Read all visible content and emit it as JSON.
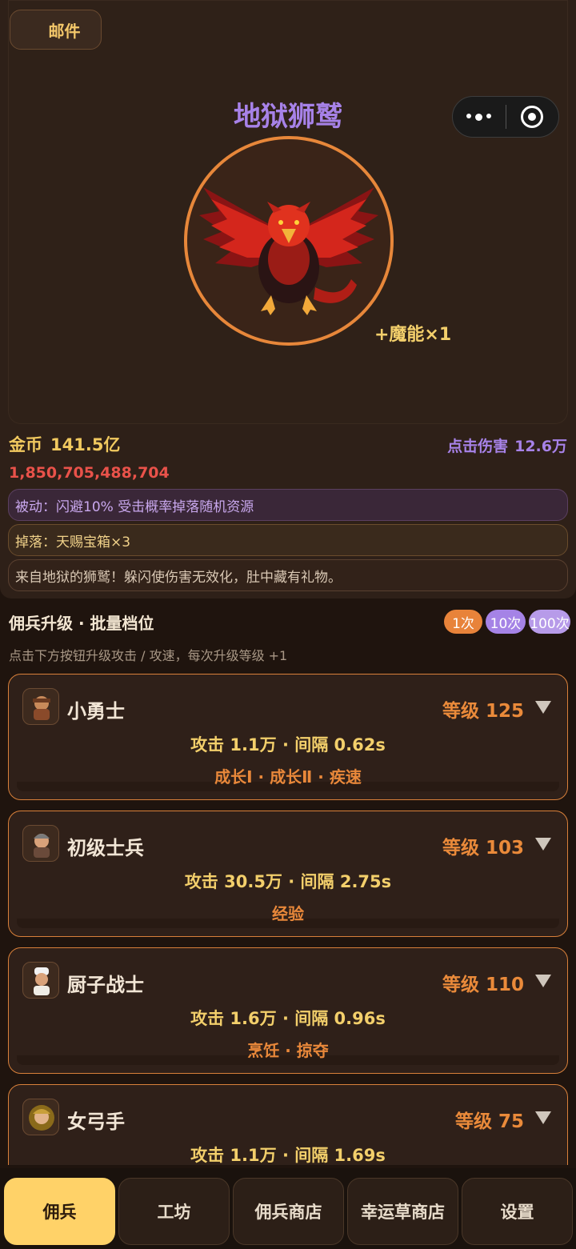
{
  "header": {
    "mail_label": "邮件",
    "capsule": {
      "more_icon": "more-dots-icon",
      "close_icon": "target-icon"
    }
  },
  "boss": {
    "name": "地狱狮鹫",
    "reward": "+魔能×1",
    "portrait": "hell-griffin",
    "colors": {
      "name": "#a782e8",
      "ring": "#e7873a"
    }
  },
  "stats": {
    "gold_label": "金币",
    "gold_value": "141.5亿",
    "click_damage_label": "点击伤害",
    "click_damage_value": "12.6万",
    "hp_raw": "1,850,705,488,704"
  },
  "info": {
    "passive": "被动：闪避10% 受击概率掉落随机资源",
    "drop": "掉落：天赐宝箱×3",
    "description": "来自地狱的狮鹫！躲闪使伤害无效化，肚中藏有礼物。"
  },
  "upgrade": {
    "title": "佣兵升级 · 批量档位",
    "batch_options": [
      "1次",
      "10次",
      "100次"
    ],
    "hint": "点击下方按钮升级攻击 / 攻速，每次升级等级 +1"
  },
  "mercenaries": [
    {
      "name": "小勇士",
      "level": "等级 125",
      "stats": "攻击 1.1万 · 间隔 0.62s",
      "tags": "成长Ⅰ · 成长Ⅱ · 疾速",
      "avatar": "warrior"
    },
    {
      "name": "初级士兵",
      "level": "等级 103",
      "stats": "攻击 30.5万 · 间隔 2.75s",
      "tags": "经验",
      "avatar": "soldier"
    },
    {
      "name": "厨子战士",
      "level": "等级 110",
      "stats": "攻击 1.6万 · 间隔 0.96s",
      "tags": "烹饪 · 掠夺",
      "avatar": "chef"
    },
    {
      "name": "女弓手",
      "level": "等级 75",
      "stats": "攻击 1.1万 · 间隔 1.69s",
      "tags": "",
      "avatar": "archer"
    }
  ],
  "tabs": [
    {
      "label": "佣兵",
      "active": true
    },
    {
      "label": "工坊",
      "active": false
    },
    {
      "label": "佣兵商店",
      "active": false
    },
    {
      "label": "幸运草商店",
      "active": false
    },
    {
      "label": "设置",
      "active": false
    }
  ]
}
